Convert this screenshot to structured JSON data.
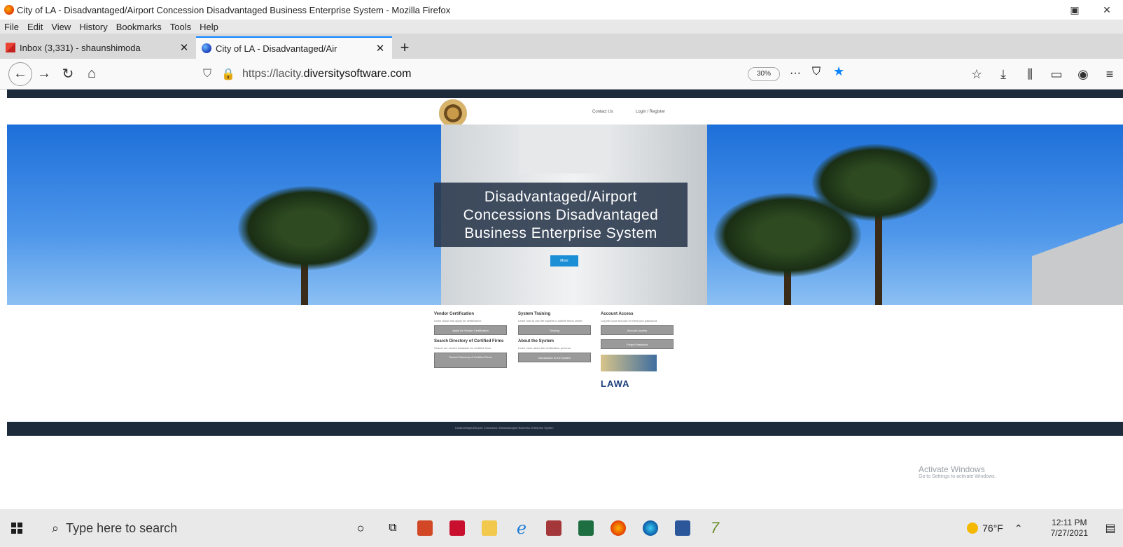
{
  "window": {
    "title": "City of LA - Disadvantaged/Airport Concession Disadvantaged Business Enterprise System - Mozilla Firefox",
    "restore_glyph": "▣",
    "close_glyph": "✕"
  },
  "menu": [
    "File",
    "Edit",
    "View",
    "History",
    "Bookmarks",
    "Tools",
    "Help"
  ],
  "tabs": [
    {
      "label": "Inbox (3,331) - shaunshimoda",
      "icon": "gmail-icon",
      "active": false
    },
    {
      "label": "City of LA - Disadvantaged/Air",
      "icon": "globe-icon",
      "active": true
    }
  ],
  "nav": {
    "url_prefix": "https://lacity.",
    "url_host": "diversitysoftware.com",
    "zoom": "30%",
    "more": "···"
  },
  "site": {
    "header_link_1": "Contact Us",
    "header_link_2": "Login / Register",
    "hero_title_line1": "Disadvantaged/Airport",
    "hero_title_line2": "Concessions Disadvantaged",
    "hero_title_line3": "Business Enterprise System",
    "hero_button": "More",
    "col1": {
      "h1": "Vendor Certification",
      "p1": "Learn about and apply for certification.",
      "btn1": "Apply for Vendor Certification",
      "h2": "Search Directory of Certified Firms",
      "p2": "Search our vendor database for certified firms.",
      "btn2": "Search Directory of Certified Firms"
    },
    "col2": {
      "h1": "System Training",
      "p1": "Learn how to use the system to submit forms online.",
      "btn1": "Training",
      "h2": "About the System",
      "p2": "Learn more about the certification process.",
      "btn2": "Introduction to the System"
    },
    "col3": {
      "h1": "Account Access",
      "p1": "Log into your account or reset your password.",
      "btn1": "Account Access",
      "btn2": "Forgot Password",
      "logo_text": "LAWA"
    },
    "footer": "Disadvantaged/Airport Concession Disadvantaged Business Enterprise System"
  },
  "activate": {
    "line1": "Activate Windows",
    "line2": "Go to Settings to activate Windows."
  },
  "taskbar": {
    "search_placeholder": "Type here to search",
    "temperature": "76°F",
    "time": "12:11 PM",
    "date": "7/27/2021"
  },
  "colors": {
    "accent": "#0a84ff",
    "page_dark": "#1d2b3a",
    "hero_box": "#28374b",
    "button_gray": "#9a9a9a"
  }
}
